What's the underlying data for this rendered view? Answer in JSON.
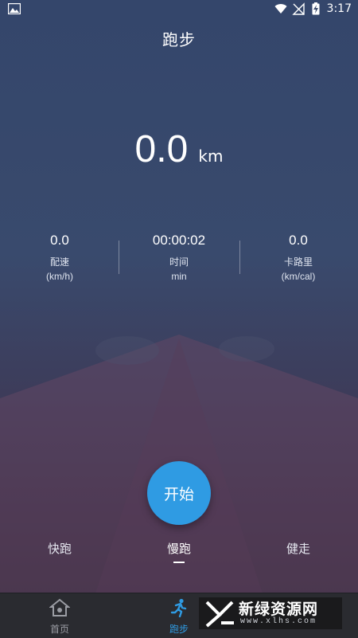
{
  "status_bar": {
    "time": "3:17"
  },
  "header": {
    "title": "跑步"
  },
  "distance": {
    "value": "0.0",
    "unit": "km"
  },
  "stats": [
    {
      "value": "0.0",
      "label": "配速",
      "unit": "(km/h)"
    },
    {
      "value": "00:00:02",
      "label": "时间",
      "unit": "min"
    },
    {
      "value": "0.0",
      "label": "卡路里",
      "unit": "(km/cal)"
    }
  ],
  "start_button": {
    "label": "开始"
  },
  "modes": [
    {
      "label": "快跑",
      "active": false
    },
    {
      "label": "慢跑",
      "active": true
    },
    {
      "label": "健走",
      "active": false
    }
  ],
  "bottom_nav": [
    {
      "label": "首页",
      "icon": "home-icon",
      "active": false
    },
    {
      "label": "跑步",
      "icon": "runner-icon",
      "active": true
    }
  ],
  "watermark": {
    "brand": "新绿资源网",
    "url": "www.xlhs.com"
  },
  "colors": {
    "accent": "#2f9be3",
    "nav_bg": "#2a2b30"
  }
}
